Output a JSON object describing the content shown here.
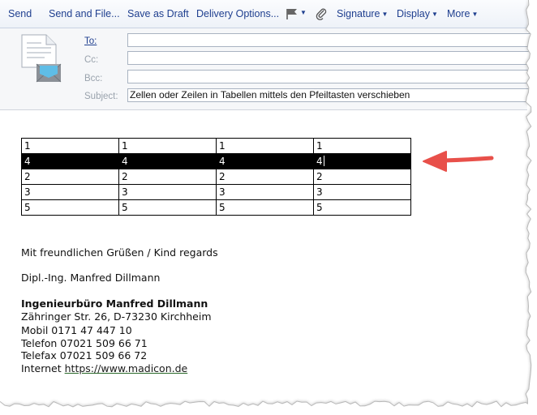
{
  "toolbar": {
    "send": "Send",
    "send_and_file": "Send and File...",
    "save_as_draft": "Save as Draft",
    "delivery_options": "Delivery Options...",
    "signature": "Signature",
    "display": "Display",
    "more": "More",
    "icons": [
      "flag-icon",
      "paperclip-icon"
    ]
  },
  "header": {
    "to_label": "To:",
    "cc_label": "Cc:",
    "bcc_label": "Bcc:",
    "subject_label": "Subject:",
    "to_value": "",
    "cc_value": "",
    "bcc_value": "",
    "subject_value": "Zellen oder Zeilen in Tabellen mittels den Pfeiltasten verschieben"
  },
  "body": {
    "table": [
      [
        "1",
        "1",
        "1",
        "1"
      ],
      [
        "4",
        "4",
        "4",
        "4"
      ],
      [
        "2",
        "2",
        "2",
        "2"
      ],
      [
        "3",
        "3",
        "3",
        "3"
      ],
      [
        "5",
        "5",
        "5",
        "5"
      ]
    ],
    "selected_row": 1,
    "signature": {
      "greeting": "Mit freundlichen Grüßen / Kind regards",
      "name": "Dipl.-Ing. Manfred Dillmann",
      "company": "Ingenieurbüro Manfred Dillmann",
      "address": "Zähringer Str. 26, D-73230 Kirchheim",
      "mobile": "Mobil 0171 47 447 10",
      "phone": "Telefon 07021 509 66 71",
      "fax": "Telefax 07021 509 66 72",
      "internet_label": "Internet",
      "url": "https://www.madicon.de"
    },
    "annotation_color": "#e8504a"
  }
}
